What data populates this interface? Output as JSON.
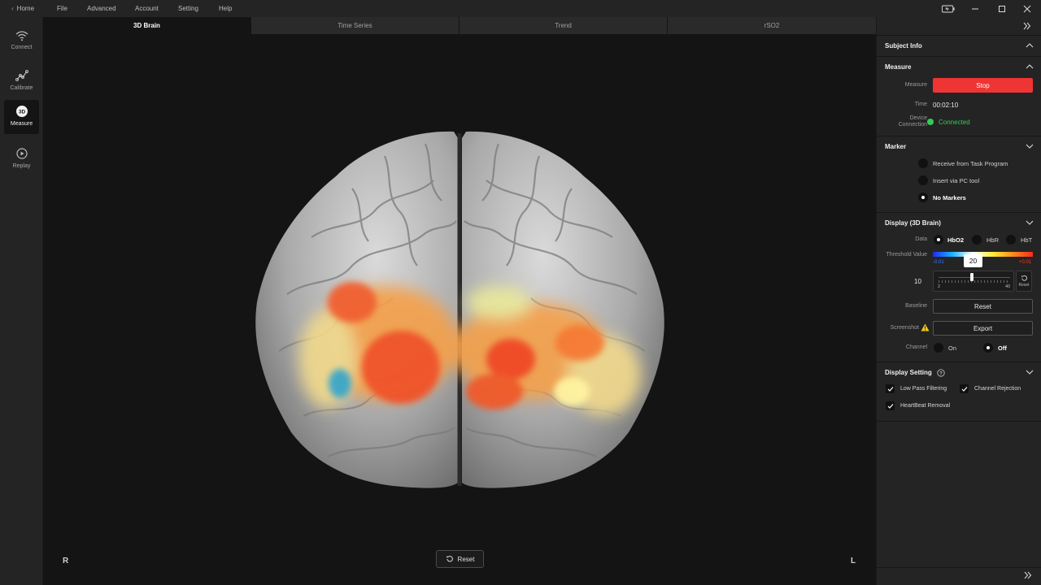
{
  "menu": {
    "home": "Home",
    "items": [
      "File",
      "Advanced",
      "Account",
      "Setting",
      "Help"
    ]
  },
  "sidebar": {
    "items": [
      {
        "label": "Connect",
        "icon": "wifi-icon"
      },
      {
        "label": "Calibrate",
        "icon": "calibrate-icon"
      },
      {
        "label": "Measure",
        "icon": "3d-brain-icon",
        "active": true
      },
      {
        "label": "Replay",
        "icon": "replay-icon"
      }
    ]
  },
  "tabs": [
    "3D Brain",
    "Time Series",
    "Trend",
    "rSO2"
  ],
  "viewer": {
    "left_label": "R",
    "right_label": "L",
    "reset_label": "Reset"
  },
  "panel": {
    "subject_info": "Subject Info",
    "measure": {
      "title": "Measure",
      "measure_label": "Measure",
      "stop_label": "Stop",
      "time_label": "Time",
      "time_value": "00:02:10",
      "device_label_1": "Device",
      "device_label_2": "Connection",
      "device_status": "Connected"
    },
    "marker": {
      "title": "Marker",
      "options": [
        "Receive from Task Program",
        "Insert via PC tool",
        "No Markers"
      ],
      "selected": "No Markers"
    },
    "display": {
      "title": "Display (3D Brain)",
      "data_label": "Data",
      "data_options": [
        "HbO2",
        "HbR",
        "HbT"
      ],
      "data_selected": "HbO2",
      "threshold_label": "Threshold Value",
      "threshold_min": "-0.01",
      "threshold_max": "+0.01",
      "threshold_left_value": "10",
      "slider_value": "20",
      "slider_min": "2",
      "slider_max": "40",
      "slider_fraction": 0.47,
      "slider_reset_label": "Reset",
      "baseline_label": "Baseline",
      "baseline_button": "Reset",
      "screenshot_label": "Screenshot",
      "export_button": "Export",
      "channel_label": "Channel",
      "channel_on": "On",
      "channel_off": "Off",
      "channel_selected": "Off"
    },
    "display_setting": {
      "title": "Display Setting",
      "options": [
        "Low Pass Filtering",
        "Channel Rejection",
        "HeartBeat Removal"
      ]
    }
  },
  "colors": {
    "stop": "#ef3434",
    "connected": "#33cc55",
    "warning": "#f2c81e"
  }
}
